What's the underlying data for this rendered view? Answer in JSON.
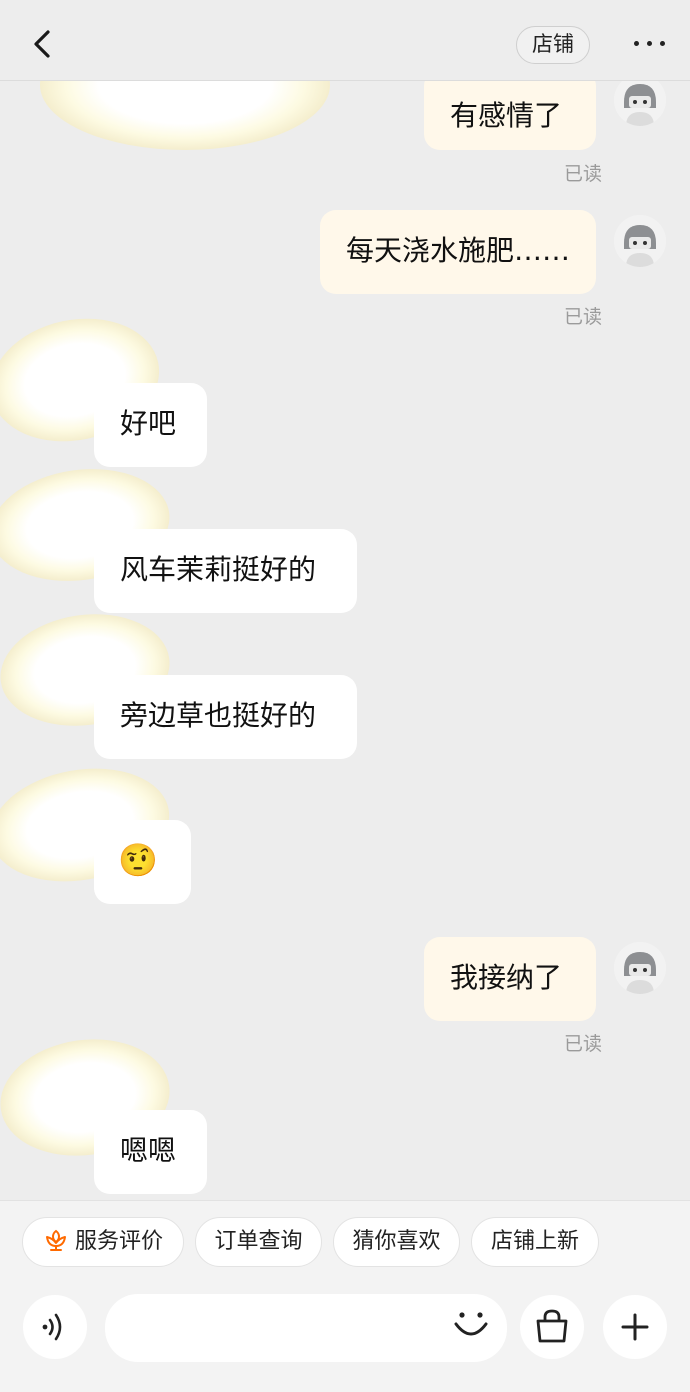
{
  "header": {
    "back_icon": "chevron-left-icon",
    "shop_label": "店铺",
    "more_icon": "more-dots-icon"
  },
  "messages": [
    {
      "side": "me",
      "text": "有感情了",
      "status": "已读"
    },
    {
      "side": "me",
      "text": "每天浇水施肥……",
      "status": "已读"
    },
    {
      "side": "other",
      "text": "好吧"
    },
    {
      "side": "other",
      "text": "风车茉莉挺好的"
    },
    {
      "side": "other",
      "text": "旁边草也挺好的"
    },
    {
      "side": "other",
      "text": "🤨"
    },
    {
      "side": "me",
      "text": "我接纳了",
      "status": "已读"
    },
    {
      "side": "other",
      "text": "嗯嗯"
    }
  ],
  "quick_actions": [
    {
      "label": "服务评价",
      "icon": "flower-icon"
    },
    {
      "label": "订单查询"
    },
    {
      "label": "猜你喜欢"
    },
    {
      "label": "店铺上新"
    }
  ],
  "input": {
    "placeholder": "",
    "voice_icon": "voice-icon",
    "emoji_icon": "smile-icon",
    "bag_icon": "shopping-bag-icon",
    "plus_icon": "plus-icon"
  },
  "colors": {
    "background": "#ededed",
    "my_bubble": "#fff8ea",
    "other_bubble": "#ffffff",
    "accent": "#ff6a00"
  }
}
